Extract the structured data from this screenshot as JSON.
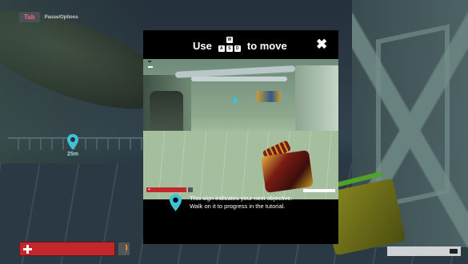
{
  "hud": {
    "tab_key": "Tab",
    "tab_label": "Pause/Options",
    "objective_distance": "25m"
  },
  "modal": {
    "title_prefix": "Use",
    "title_suffix": "to move",
    "keys": [
      "W",
      "A",
      "S",
      "D"
    ],
    "close_icon": "close-icon",
    "instruction_line1": "This sign indicates your next objective.",
    "instruction_line2": "Walk on it to progress in the tutorial."
  },
  "colors": {
    "objective_marker": "#3fc1d6",
    "health_bar": "#c2272b",
    "modal_bg": "#000000",
    "tab_key_text": "#f26b70"
  }
}
